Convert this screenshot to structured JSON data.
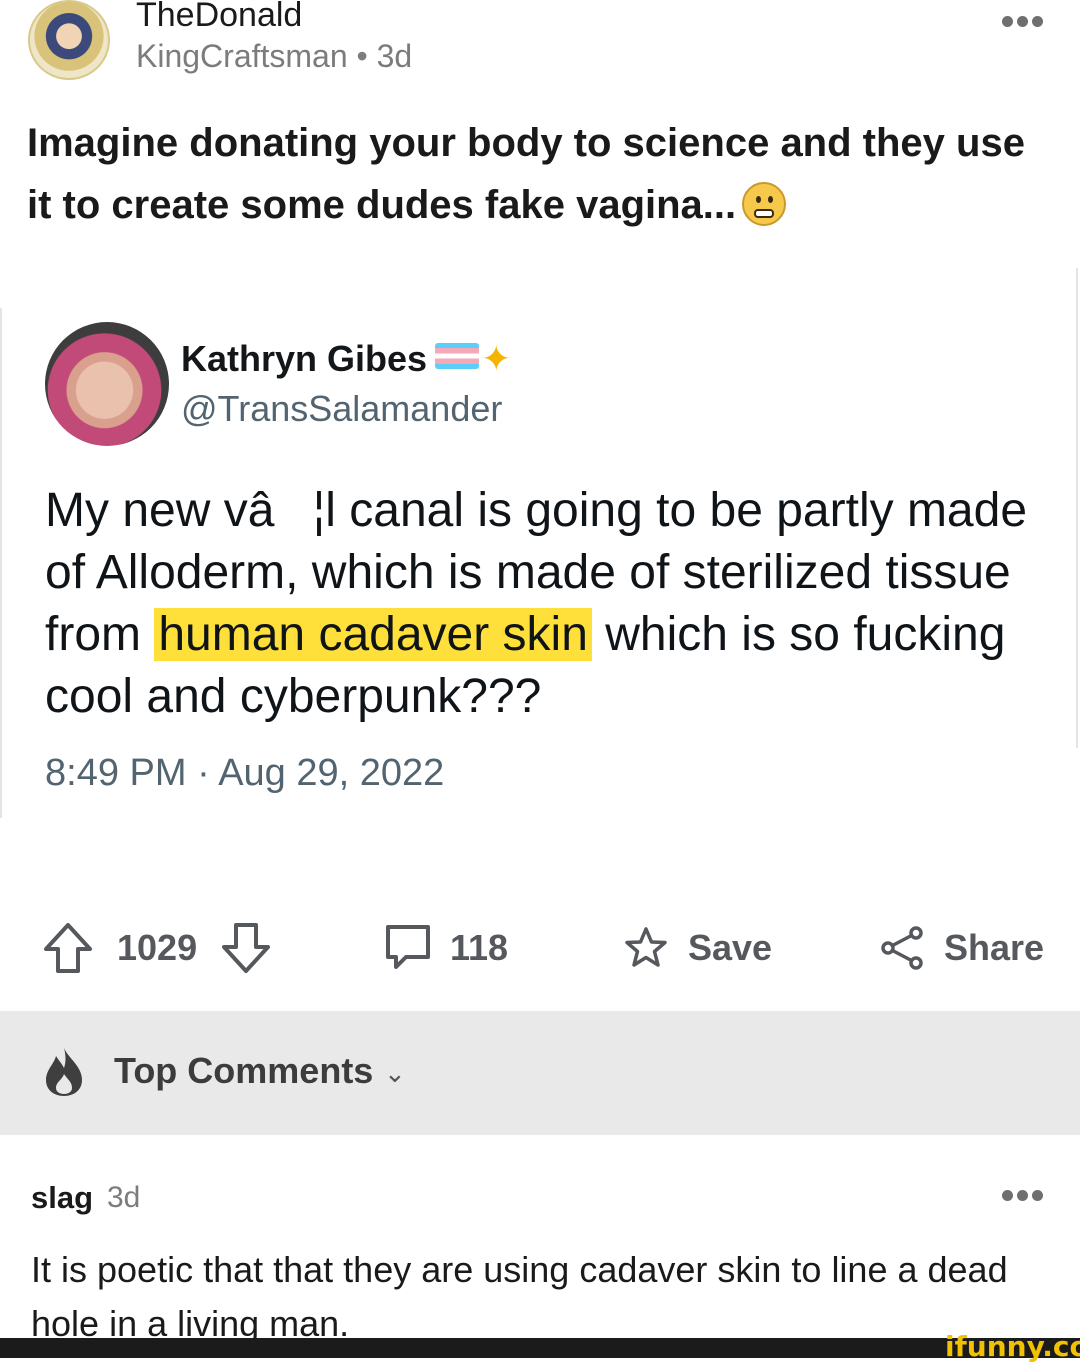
{
  "post": {
    "subreddit": "TheDonald",
    "author": "KingCraftsman",
    "separator": "•",
    "age": "3d",
    "title": "Imagine donating your body to science and they use it to create some dudes fake vagina..."
  },
  "tweet": {
    "name": "Kathryn Gibes",
    "handle": "@TransSalamander",
    "text_before": "My new vâ¦l canal is going to be partly made of Alloderm, which is made of sterilized tissue from ",
    "highlight": "human cadaver skin",
    "text_after": " which is so fucking cool and cyberpunk???",
    "timestamp": "8:49 PM · Aug 29, 2022"
  },
  "actions": {
    "score": "1029",
    "comments": "118",
    "save_label": "Save",
    "share_label": "Share"
  },
  "comments_section": {
    "sort_label": "Top Comments"
  },
  "comment": {
    "user": "slag",
    "age": "3d",
    "body": "It is poetic that that they are using cadaver skin to line a dead hole in a living man."
  },
  "watermark": "ifunny.co",
  "icons": [
    "subreddit-avatar",
    "more-dots-icon",
    "grimace-emoji",
    "trans-flag-icon",
    "sparkle-icon",
    "upvote-icon",
    "downvote-icon",
    "comment-icon",
    "star-icon",
    "share-icon",
    "flame-icon",
    "chevron-down-icon"
  ],
  "colors": {
    "highlight": "#ffe03a",
    "band": "#e9e9e9",
    "watermark": "#f2c200"
  }
}
